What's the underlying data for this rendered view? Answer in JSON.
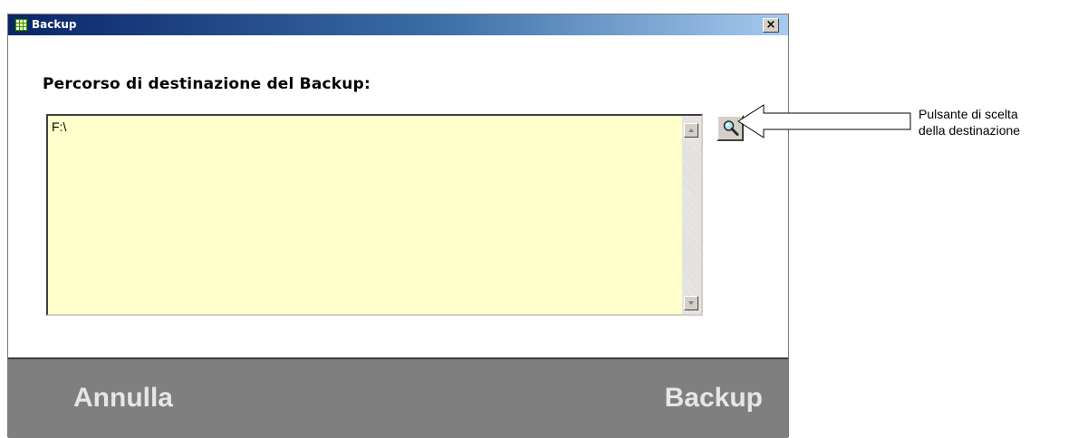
{
  "window": {
    "title": "Backup",
    "close_label": "×"
  },
  "content": {
    "path_label": "Percorso di destinazione del Backup:",
    "path_value": "F:\\"
  },
  "footer": {
    "cancel_label": "Annulla",
    "backup_label": "Backup"
  },
  "annotation": {
    "line1": "Pulsante di scelta",
    "line2": "della destinazione"
  },
  "colors": {
    "titlebar_start": "#0a246a",
    "titlebar_end": "#a6caf0",
    "path_background": "#ffffcc",
    "footer_background": "#7f7f7f",
    "footer_text": "#e6e6e6"
  },
  "icons": {
    "app": "app-icon",
    "browse": "magnifier-icon"
  }
}
